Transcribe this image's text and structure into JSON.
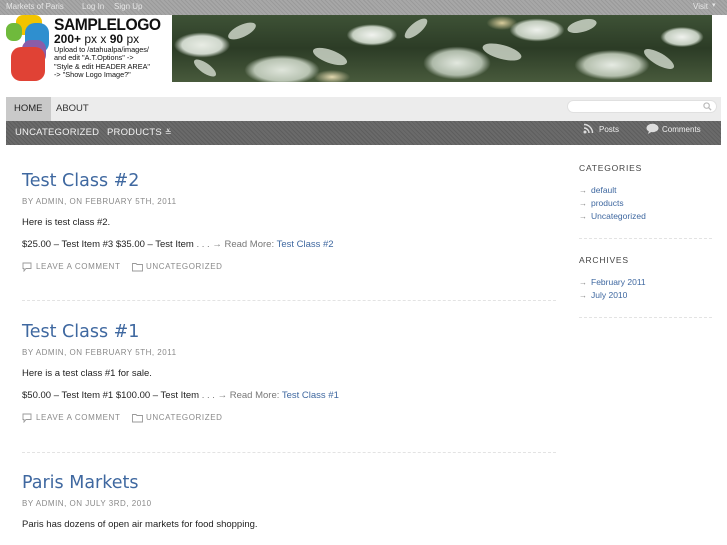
{
  "topbar": {
    "site_link": "Markets of Paris",
    "login": "Log In",
    "signup": "Sign Up",
    "visit": "Visit"
  },
  "logo": {
    "title": "SAMPLELOGO",
    "size_a": "200+",
    "size_unit_a": "px",
    "size_x": "x",
    "size_b": "90",
    "size_unit_b": "px",
    "line1": "Upload to /atahualpa/images/",
    "line2": "and edit \"A.T.Options\" ->",
    "line3": "\"Style & edit HEADER AREA\"",
    "line4": "-> \"Show Logo Image?\"",
    "colors": [
      "#f2c400",
      "#2f8fcf",
      "#e04235",
      "#6fba3c",
      "#8a5da8"
    ]
  },
  "nav": {
    "home": "HOME",
    "about": "ABOUT",
    "search_placeholder": ""
  },
  "subnav": {
    "uncategorized": "UNCATEGORIZED",
    "products": "PRODUCTS",
    "posts": "Posts",
    "comments": "Comments"
  },
  "posts": [
    {
      "title": "Test Class #2",
      "meta": "By admin, on February 5th, 2011",
      "excerpt": "Here is test class #2.",
      "price_line": "$25.00 – Test Item #3 $35.00 – Test Item",
      "ellipsis": ". . .",
      "read_more": "→ Read More:",
      "read_more_link": "Test Class #2",
      "leave_comment": "Leave a comment",
      "category": "Uncategorized"
    },
    {
      "title": "Test Class #1",
      "meta": "By admin, on February 5th, 2011",
      "excerpt": "Here is a test class #1 for sale.",
      "price_line": "$50.00 – Test Item #1 $100.00 – Test Item",
      "ellipsis": ". . .",
      "read_more": "→ Read More:",
      "read_more_link": "Test Class #1",
      "leave_comment": "Leave a comment",
      "category": "Uncategorized"
    },
    {
      "title": "Paris Markets",
      "meta": "By admin, on July 3rd, 2010",
      "excerpt": "Paris has dozens of open air markets for food shopping."
    }
  ],
  "sidebar": {
    "categories_title": "Categories",
    "categories": [
      "default",
      "products",
      "Uncategorized"
    ],
    "archives_title": "Archives",
    "archives": [
      "February 2011",
      "July 2010"
    ],
    "arrow": "→"
  }
}
